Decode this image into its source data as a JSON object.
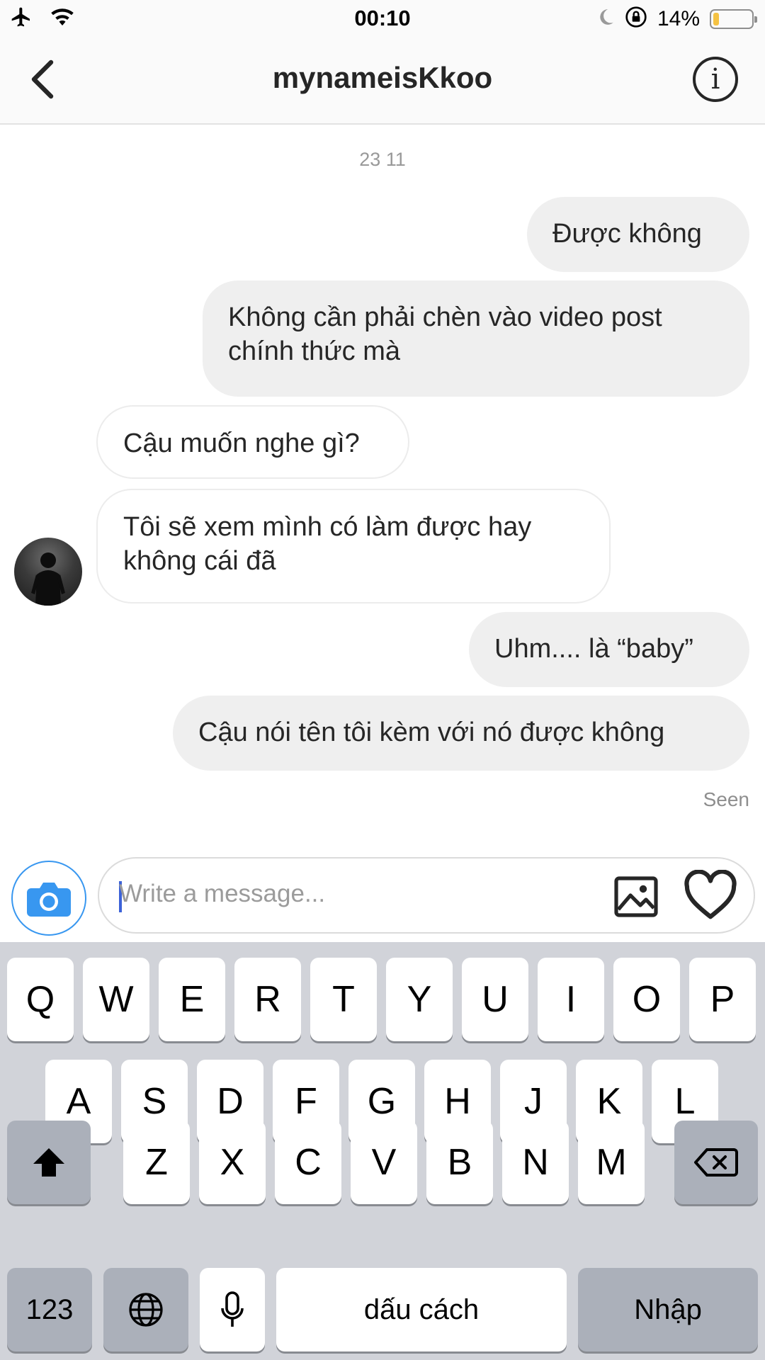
{
  "status_bar": {
    "time": "00:10",
    "battery_percent": "14%",
    "battery_level": 0.14,
    "icons": [
      "airplane-icon",
      "wifi-icon",
      "moon-icon",
      "rotation-lock-icon",
      "battery-icon"
    ]
  },
  "header": {
    "title": "mynameisKkoo",
    "back_icon": "chevron-left-icon",
    "info_label": "i"
  },
  "conversation": {
    "date_label": "23 11",
    "messages": [
      {
        "direction": "out",
        "text": "Được không"
      },
      {
        "direction": "out",
        "text": "Không cần phải chèn vào video post chính thức mà"
      },
      {
        "direction": "in",
        "text": "Cậu muốn nghe gì?"
      },
      {
        "direction": "in",
        "text": "Tôi sẽ xem mình có làm được hay không cái đã"
      },
      {
        "direction": "out",
        "text": "Uhm.... là “baby”"
      },
      {
        "direction": "out",
        "text": "Cậu nói tên tôi kèm với nó được không"
      }
    ],
    "seen_label": "Seen"
  },
  "composer": {
    "placeholder": "Write a message...",
    "icons": [
      "camera-icon",
      "gallery-icon",
      "heart-icon"
    ]
  },
  "keyboard": {
    "row1": [
      "Q",
      "W",
      "E",
      "R",
      "T",
      "Y",
      "U",
      "I",
      "O",
      "P"
    ],
    "row2": [
      "A",
      "S",
      "D",
      "F",
      "G",
      "H",
      "J",
      "K",
      "L"
    ],
    "row3": [
      "Z",
      "X",
      "C",
      "V",
      "B",
      "N",
      "M"
    ],
    "numbers_label": "123",
    "space_label": "dấu cách",
    "return_label": "Nhập",
    "icons": [
      "shift-icon",
      "backspace-icon",
      "globe-icon",
      "microphone-icon"
    ]
  },
  "colors": {
    "accent_blue": "#3897f0",
    "outgoing_bubble": "#efefef",
    "keyboard_bg": "#d1d3d9",
    "battery_fill": "#f5c242"
  }
}
